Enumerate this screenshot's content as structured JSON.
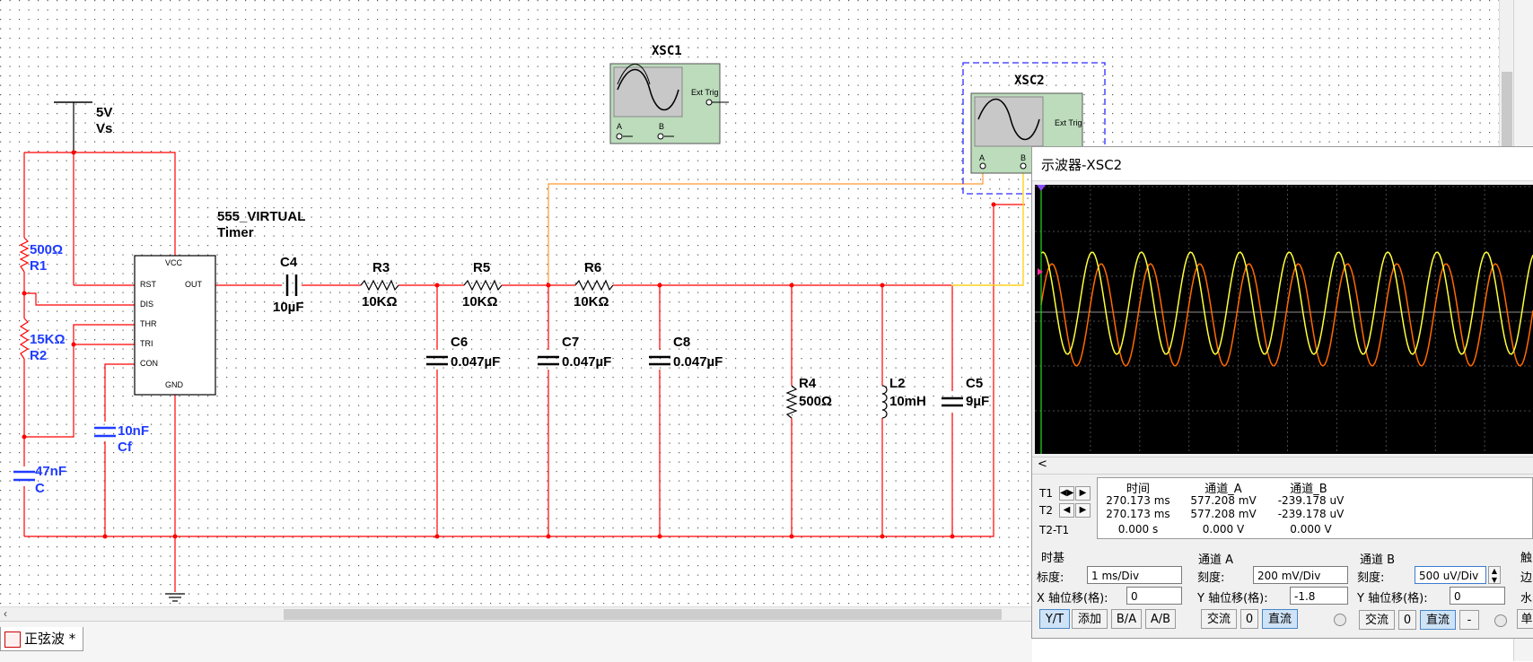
{
  "circuit": {
    "supply": {
      "value": "5V",
      "name": "Vs"
    },
    "timer": {
      "model": "555_VIRTUAL",
      "type": "Timer",
      "pins": [
        "VCC",
        "RST",
        "OUT",
        "DIS",
        "THR",
        "TRI",
        "CON",
        "GND"
      ]
    },
    "components": [
      {
        "id": "R1",
        "value": "500Ω"
      },
      {
        "id": "R2",
        "value": "15KΩ"
      },
      {
        "id": "C",
        "value": "47nF"
      },
      {
        "id": "Cf",
        "value": "10nF"
      },
      {
        "id": "C4",
        "value": "10µF"
      },
      {
        "id": "R3",
        "value": "10KΩ"
      },
      {
        "id": "R5",
        "value": "10KΩ"
      },
      {
        "id": "R6",
        "value": "10KΩ"
      },
      {
        "id": "C6",
        "value": "0.047µF"
      },
      {
        "id": "C7",
        "value": "0.047µF"
      },
      {
        "id": "C8",
        "value": "0.047µF"
      },
      {
        "id": "R4",
        "value": "500Ω"
      },
      {
        "id": "L2",
        "value": "10mH"
      },
      {
        "id": "C5",
        "value": "9µF"
      }
    ],
    "instruments": [
      {
        "name": "XSC1",
        "ext_trig": "Ext Trig",
        "ch_a": "A",
        "ch_b": "B"
      },
      {
        "name": "XSC2",
        "ext_trig": "Ext Trig",
        "ch_a": "A",
        "ch_b": "B"
      }
    ]
  },
  "tab": {
    "label": "正弦波 *"
  },
  "scope": {
    "title": "示波器-XSC2",
    "hscroll_arrow": "<",
    "readout": {
      "row_labels": [
        "T1",
        "T2",
        "T2-T1"
      ],
      "headers": [
        "时间",
        "通道_A",
        "通道_B"
      ],
      "rows": [
        [
          "270.173 ms",
          "577.208 mV",
          "-239.178 uV"
        ],
        [
          "270.173 ms",
          "577.208 mV",
          "-239.178 uV"
        ],
        [
          "0.000 s",
          "0.000 V",
          "0.000 V"
        ]
      ]
    },
    "timebase": {
      "section": "时基",
      "scale_label": "标度:",
      "scale_value": "1 ms/Div",
      "xpos_label": "X 轴位移(格):",
      "xpos_value": "0",
      "buttons": [
        "Y/T",
        "添加",
        "B/A",
        "A/B"
      ]
    },
    "channel_a": {
      "section": "通道 A",
      "scale_label": "刻度:",
      "scale_value": "200 mV/Div",
      "ypos_label": "Y 轴位移(格):",
      "ypos_value": "-1.8",
      "buttons": [
        "交流",
        "0",
        "直流"
      ]
    },
    "channel_b": {
      "section": "通道 B",
      "scale_label": "刻度:",
      "scale_value": "500 uV/Div",
      "ypos_label": "Y 轴位移(格):",
      "ypos_value": "0",
      "buttons": [
        "交流",
        "0",
        "直流",
        "-"
      ]
    },
    "trigger": {
      "section_partial": "触",
      "edge_partial": "边",
      "level_partial": "水",
      "single_partial": "单"
    },
    "waveform_colors": {
      "channel_a": "#ff6a00",
      "channel_b": "#ffff3a",
      "grid": "#4a4a4a"
    },
    "wave_cycles_visible": 10
  },
  "colors": {
    "wire": "#ff0000",
    "wire_a": "#ff9933",
    "wire_b": "#ffd21f",
    "label_blue": "#1f3cff",
    "label_black": "#000000",
    "scope_body": "#bcdcbc"
  }
}
